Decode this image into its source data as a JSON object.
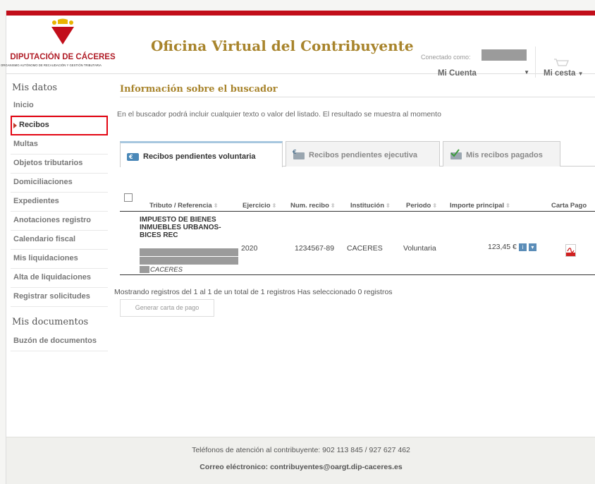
{
  "header": {
    "org_name": "DIPUTACIÓN DE CÁCERES",
    "org_sub": "ORGANISMO AUTÓNOMO DE RECAUDACIÓN Y GESTIÓN TRIBUTARIA",
    "title": "Oficina Virtual del Contribuyente",
    "connected_label": "Conectado como:",
    "account_label": "Mi Cuenta",
    "cart_label": "Mi cesta"
  },
  "sidebar": {
    "section1": "Mis datos",
    "items": [
      {
        "label": "Inicio"
      },
      {
        "label": "Recibos"
      },
      {
        "label": "Multas"
      },
      {
        "label": "Objetos tributarios"
      },
      {
        "label": "Domiciliaciones"
      },
      {
        "label": "Expedientes"
      },
      {
        "label": "Anotaciones registro"
      },
      {
        "label": "Calendario fiscal"
      },
      {
        "label": "Mis liquidaciones"
      },
      {
        "label": "Alta de liquidaciones"
      },
      {
        "label": "Registrar solicitudes"
      }
    ],
    "section2": "Mis documentos",
    "items2": [
      {
        "label": "Buzón de documentos"
      }
    ]
  },
  "main": {
    "info_title": "Información sobre el buscador",
    "info_text": "En el buscador podrá incluir cualquier texto o valor del listado. El resultado se muestra al momento",
    "tabs": [
      {
        "label": "Recibos pendientes voluntaria"
      },
      {
        "label": "Recibos pendientes ejecutiva"
      },
      {
        "label": "Mis recibos pagados"
      }
    ],
    "columns": {
      "tributo": "Tributo  /  Referencia",
      "ejercicio": "Ejercicio",
      "num_recibo": "Num. recibo",
      "institucion": "Institución",
      "periodo": "Periodo",
      "importe": "Importe principal",
      "carta": "Carta Pago"
    },
    "row": {
      "tributo": "IMPUESTO DE BIENES INMUEBLES URBANOS-BICES REC",
      "city": "CACERES",
      "ejercicio": "2020",
      "num_recibo": "1234567-89",
      "institucion": "CACERES",
      "periodo": "Voluntaria",
      "importe": "123,45 €"
    },
    "records_info": "Mostrando registros del 1 al 1 de un total de 1 registros   Has seleccionado 0 registros",
    "generate_button": "Generar carta de pago"
  },
  "footer": {
    "phones": "Teléfonos de atención al contribuyente: 902 113 845  /  927 627 462",
    "email": "Correo eléctronico: contribuyentes@oargt.dip-caceres.es"
  }
}
